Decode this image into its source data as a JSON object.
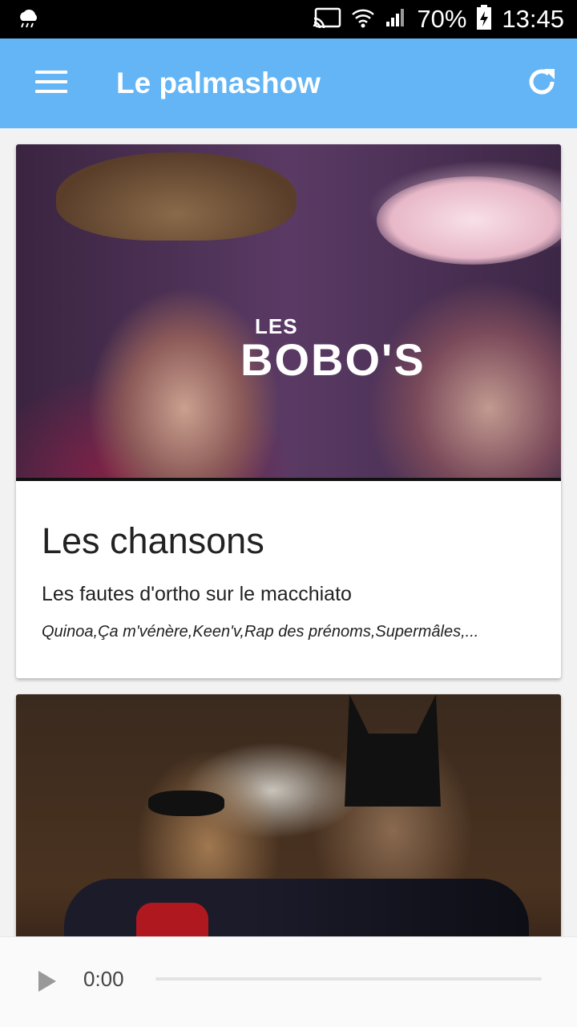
{
  "status_bar": {
    "weather_icon": "cloud-rain-icon",
    "battery": "70%",
    "time": "13:45"
  },
  "app_bar": {
    "title": "Le palmashow",
    "menu_icon": "hamburger-menu-icon",
    "refresh_icon": "refresh-icon",
    "color": "#64b5f6"
  },
  "cards": [
    {
      "image_text_small": "LES",
      "image_text_large": "BOBO'S",
      "title": "Les chansons",
      "subtitle": "Les fautes d'ortho sur le macchiato",
      "note": "Quinoa,Ça m'vénère,Keen'v,Rap des prénoms,Supermâles,..."
    },
    {
      "image": "batman-robin-thumbnail"
    }
  ],
  "player": {
    "time": "0:00",
    "progress": 0,
    "play_icon": "play-icon"
  }
}
